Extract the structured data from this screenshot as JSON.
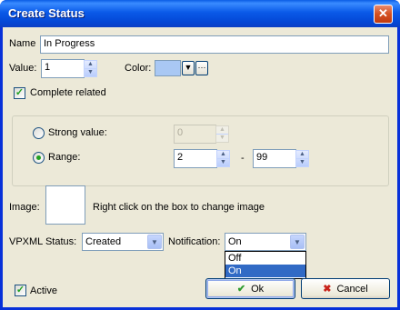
{
  "window": {
    "title": "Create Status",
    "close_glyph": "✕"
  },
  "name": {
    "label": "Name",
    "value": "In Progress"
  },
  "value": {
    "label": "Value:",
    "value": "1"
  },
  "color": {
    "label": "Color:",
    "swatch_color": "#a9c8f4",
    "more_glyph": "···"
  },
  "complete_related": {
    "label": "Complete related",
    "checked": true
  },
  "group": {
    "strong_value": {
      "label": "Strong value:",
      "value": "0",
      "selected": false
    },
    "range": {
      "label": "Range:",
      "from": "2",
      "separator": "-",
      "to": "99",
      "selected": true
    }
  },
  "image": {
    "label": "Image:",
    "hint": "Right click on the box to  change image"
  },
  "vpxml": {
    "label": "VPXML Status:",
    "value": "Created"
  },
  "notification": {
    "label": "Notification:",
    "value": "On",
    "options": [
      "Off",
      "On"
    ],
    "selected_index": 1
  },
  "active": {
    "label": "Active",
    "checked": true
  },
  "buttons": {
    "ok": "Ok",
    "cancel": "Cancel"
  },
  "colors": {
    "title_bar": "#0a5ae8",
    "dialog_bg": "#ece9d8",
    "selection": "#316ac5"
  }
}
